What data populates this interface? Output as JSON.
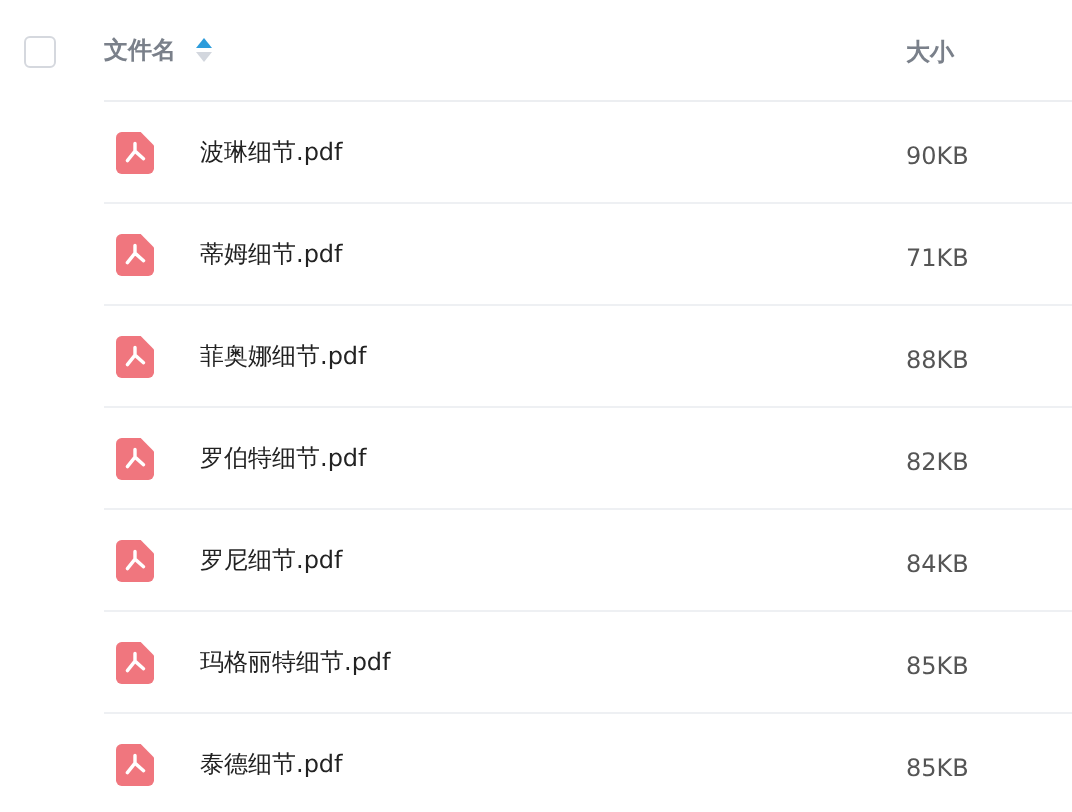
{
  "header": {
    "select_all": {
      "checked": false
    },
    "columns": [
      {
        "label": "文件名",
        "sorted_ascending": true
      },
      {
        "label": "大小"
      }
    ]
  },
  "files": [
    {
      "name": "波琳细节.pdf",
      "size": "90KB"
    },
    {
      "name": "蒂姆细节.pdf",
      "size": "71KB"
    },
    {
      "name": "菲奥娜细节.pdf",
      "size": "88KB"
    },
    {
      "name": "罗伯特细节.pdf",
      "size": "82KB"
    },
    {
      "name": "罗尼细节.pdf",
      "size": "84KB"
    },
    {
      "name": "玛格丽特细节.pdf",
      "size": "85KB"
    },
    {
      "name": "泰德细节.pdf",
      "size": "85KB"
    }
  ]
}
